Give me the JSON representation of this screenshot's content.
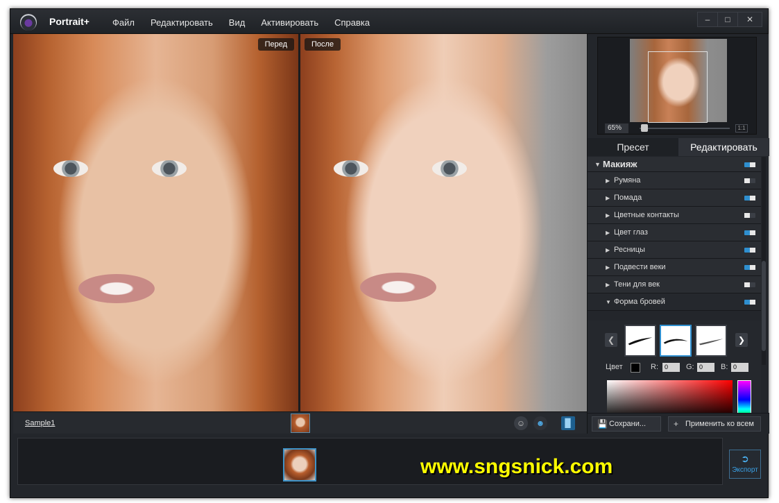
{
  "app": {
    "title": "Portrait+"
  },
  "menu": [
    "Файл",
    "Редактировать",
    "Вид",
    "Активировать",
    "Справка"
  ],
  "window_controls": [
    "–",
    "□",
    "✕"
  ],
  "photos": {
    "before_label": "Перед",
    "after_label": "После"
  },
  "strip": {
    "filename": "Sample1"
  },
  "navigator": {
    "zoom": "65%",
    "one_to_one": "1:1"
  },
  "tabs": [
    {
      "label": "Пресет",
      "active": false
    },
    {
      "label": "Редактировать",
      "active": true
    }
  ],
  "section": {
    "label": "Макияж",
    "enabled": true
  },
  "items": [
    {
      "label": "Румяна",
      "enabled": false
    },
    {
      "label": "Помада",
      "enabled": true
    },
    {
      "label": "Цветные контакты",
      "enabled": false
    },
    {
      "label": "Цвет глаз",
      "enabled": true
    },
    {
      "label": "Ресницы",
      "enabled": true
    },
    {
      "label": "Подвести веки",
      "enabled": true
    },
    {
      "label": "Тени для век",
      "enabled": false
    },
    {
      "label": "Форма бровей",
      "enabled": true,
      "expanded": true
    }
  ],
  "brow": {
    "color_label": "Цвет",
    "r_label": "R:",
    "r": "0",
    "g_label": "G:",
    "g": "0",
    "b_label": "B:",
    "b": "0",
    "selected_preset": 2
  },
  "buttons": {
    "save": "Сохрани...",
    "apply_all": "Применить ко всем",
    "export": "Экспорт"
  },
  "watermark": "www.sngsnick.com",
  "colors": {
    "accent": "#2f8fcf",
    "watermark": "#ffff00",
    "background": "#23262b"
  }
}
